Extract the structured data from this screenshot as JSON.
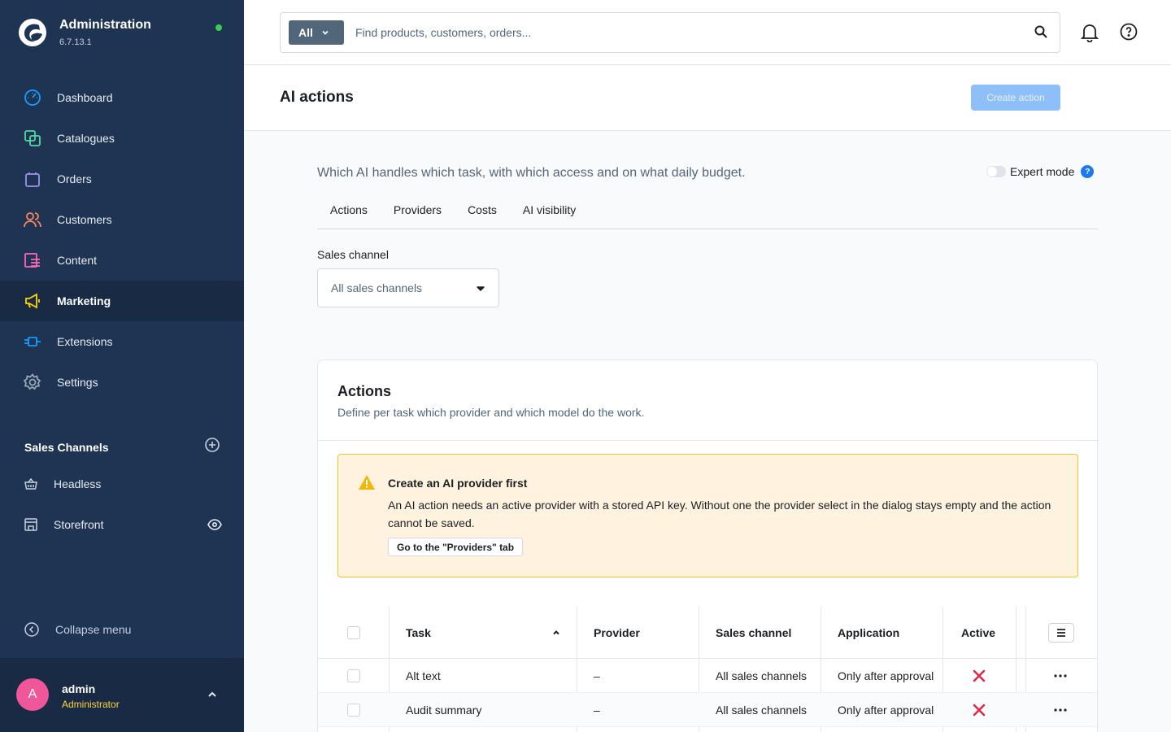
{
  "app": {
    "title": "Administration",
    "version": "6.7.13.1"
  },
  "nav": {
    "items": [
      {
        "label": "Dashboard",
        "icon": "dashboard-icon",
        "color": "#189eff"
      },
      {
        "label": "Catalogues",
        "icon": "catalogue-icon",
        "color": "#57d9a3"
      },
      {
        "label": "Orders",
        "icon": "orders-icon",
        "color": "#a092f0"
      },
      {
        "label": "Customers",
        "icon": "customers-icon",
        "color": "#f88962"
      },
      {
        "label": "Content",
        "icon": "content-icon",
        "color": "#ff68b4"
      },
      {
        "label": "Marketing",
        "icon": "marketing-icon",
        "color": "#ffd700",
        "active": true
      },
      {
        "label": "Extensions",
        "icon": "extensions-icon",
        "color": "#189eff"
      },
      {
        "label": "Settings",
        "icon": "settings-icon",
        "color": "#9aa8b5"
      }
    ]
  },
  "sales_channels": {
    "title": "Sales Channels",
    "items": [
      {
        "label": "Headless",
        "icon": "basket-icon"
      },
      {
        "label": "Storefront",
        "icon": "storefront-icon"
      }
    ]
  },
  "collapse_label": "Collapse menu",
  "user": {
    "initial": "A",
    "name": "admin",
    "role": "Administrator"
  },
  "search": {
    "scope": "All",
    "placeholder": "Find products, customers, orders..."
  },
  "page": {
    "title": "AI actions",
    "create_button": "Create action"
  },
  "intro": "Which AI handles which task, with which access and on what daily budget.",
  "expert_mode": {
    "label": "Expert mode",
    "help": "?",
    "enabled": false
  },
  "tabs": [
    "Actions",
    "Providers",
    "Costs",
    "AI visibility"
  ],
  "sales_channel_field": {
    "label": "Sales channel",
    "value": "All sales channels"
  },
  "card": {
    "title": "Actions",
    "subtitle": "Define per task which provider and which model do the work.",
    "alert": {
      "title": "Create an AI provider first",
      "text": "An AI action needs an active provider with a stored API key. Without one the provider select in the dialog stays empty and the action cannot be saved.",
      "button": "Go to the \"Providers\" tab"
    },
    "table": {
      "columns": [
        "Task",
        "Provider",
        "Sales channel",
        "Application",
        "Active"
      ],
      "sort": {
        "column": "Task",
        "direction": "asc"
      },
      "rows": [
        {
          "task": "Alt text",
          "provider": "–",
          "sales_channel": "All sales channels",
          "application": "Only after approval",
          "active": false
        },
        {
          "task": "Audit summary",
          "provider": "–",
          "sales_channel": "All sales channels",
          "application": "Only after approval",
          "active": false
        }
      ]
    }
  }
}
